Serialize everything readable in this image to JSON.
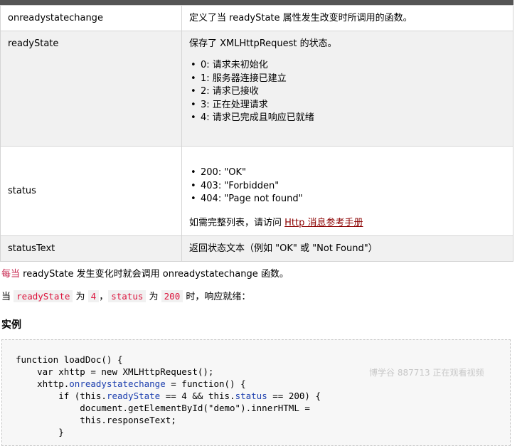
{
  "table": {
    "rows": [
      {
        "name": "onreadystatechange",
        "desc": "定义了当 readyState 属性发生改变时所调用的函数。"
      },
      {
        "name": "readyState",
        "desc": "保存了 XMLHttpRequest 的状态。",
        "items": [
          "0: 请求未初始化",
          "1: 服务器连接已建立",
          "2: 请求已接收",
          "3: 正在处理请求",
          "4: 请求已完成且响应已就绪"
        ]
      },
      {
        "name": "status",
        "items": [
          "200: \"OK\"",
          "403: \"Forbidden\"",
          "404: \"Page not found\""
        ],
        "more_prefix": "如需完整列表，请访问 ",
        "more_link": "Http 消息参考手册"
      },
      {
        "name": "statusText",
        "desc": "返回状态文本（例如 \"OK\" 或 \"Not Found\"）"
      }
    ]
  },
  "sentence1": {
    "highlight": "每当",
    "rest": " readyState 发生变化时就会调用 onreadystatechange 函数。"
  },
  "sentence2": {
    "prefix": "当 ",
    "code1": "readyState",
    "mid1": " 为 ",
    "code2": "4",
    "mid2": "，",
    "code3": "status",
    "mid3": " 为 ",
    "code4": "200",
    "suffix": " 时，响应就绪："
  },
  "example_heading": "实例",
  "code": {
    "line1": "function loadDoc() {",
    "line2": "    var xhttp = new XMLHttpRequest();",
    "line3_a": "    xhttp.",
    "line3_b": "onreadystatechange",
    "line3_c": " = function() {",
    "line4_a": "        if (this.",
    "line4_b": "readyState",
    "line4_c": " == 4 && this.",
    "line4_d": "status",
    "line4_e": " == 200) {",
    "line5": "            document.getElementById(\"demo\").innerHTML =",
    "line6": "            this.responseText;",
    "line7": "        }"
  },
  "watermark": "博学谷 887713 正在观看视频"
}
